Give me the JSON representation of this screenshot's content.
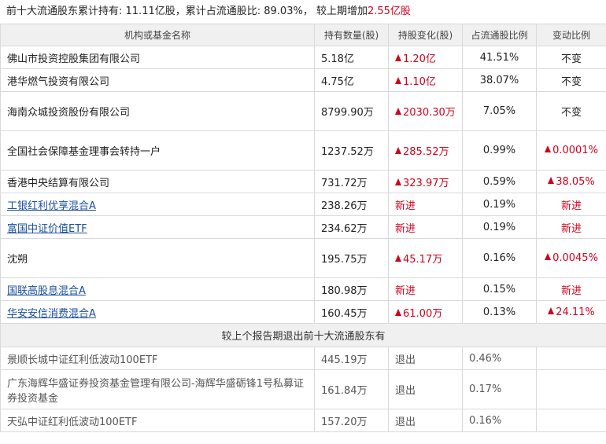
{
  "summary": {
    "prefix": "前十大流通股东累计持有: ",
    "total_hold": "11.11亿股",
    "ratio_label": "，累计占流通股比: ",
    "ratio": "89.03%",
    "change_label": "， 较上期增加",
    "change_value": "2.55亿股"
  },
  "table": {
    "headers": [
      "机构或基金名称",
      "持有数量(股)",
      "持股变化(股)",
      "占流通股比例",
      "变动比例"
    ],
    "rows": [
      {
        "name": "佛山市投资控股集团有限公司",
        "link": false,
        "qty": "5.18亿",
        "change": "1.20亿",
        "change_up": true,
        "ratio": "41.51%",
        "pct": "不变",
        "pct_up": false,
        "pct_red": false
      },
      {
        "name": "港华燃气投资有限公司",
        "link": false,
        "qty": "4.75亿",
        "change": "1.10亿",
        "change_up": true,
        "ratio": "38.07%",
        "pct": "不变",
        "pct_up": false,
        "pct_red": false
      },
      {
        "name": "海南众城投资股份有限公司",
        "link": false,
        "qty": "8799.90万",
        "change": "2030.30万",
        "change_up": true,
        "ratio": "7.05%",
        "pct": "不变",
        "pct_up": false,
        "pct_red": false
      },
      {
        "name": "全国社会保障基金理事会转持一户",
        "link": false,
        "qty": "1237.52万",
        "change": "285.52万",
        "change_up": true,
        "ratio": "0.99%",
        "pct": "0.0001%",
        "pct_up": true,
        "pct_red": true
      },
      {
        "name": "香港中央结算有限公司",
        "link": false,
        "qty": "731.72万",
        "change": "323.97万",
        "change_up": true,
        "ratio": "0.59%",
        "pct": "38.05%",
        "pct_up": true,
        "pct_red": true
      },
      {
        "name": "工银红利优享混合A",
        "link": true,
        "qty": "238.26万",
        "change": "新进",
        "change_up": false,
        "ratio": "0.19%",
        "pct": "新进",
        "pct_up": false,
        "pct_red": true
      },
      {
        "name": "富国中证价值ETF",
        "link": true,
        "qty": "234.62万",
        "change": "新进",
        "change_up": false,
        "ratio": "0.19%",
        "pct": "新进",
        "pct_up": false,
        "pct_red": true
      },
      {
        "name": "沈朔",
        "link": false,
        "qty": "195.75万",
        "change": "45.17万",
        "change_up": true,
        "ratio": "0.16%",
        "pct": "0.0045%",
        "pct_up": true,
        "pct_red": true
      },
      {
        "name": "国联高股息混合A",
        "link": true,
        "qty": "180.98万",
        "change": "新进",
        "change_up": false,
        "ratio": "0.15%",
        "pct": "新进",
        "pct_up": false,
        "pct_red": true
      },
      {
        "name": "华安安信消费混合A",
        "link": true,
        "qty": "160.45万",
        "change": "61.00万",
        "change_up": true,
        "ratio": "0.13%",
        "pct": "24.11%",
        "pct_up": true,
        "pct_red": true
      }
    ],
    "section_title": "较上个报告期退出前十大流通股东有",
    "exits": [
      {
        "name": "景顺长城中证红利低波动100ETF",
        "qty": "445.19万",
        "change": "退出",
        "ratio": "0.46%"
      },
      {
        "name": "广东海辉华盛证券投资基金管理有限公司-海辉华盛砺锋1号私募证券投资基金",
        "qty": "161.84万",
        "change": "退出",
        "ratio": "0.17%"
      },
      {
        "name": "天弘中证红利低波动100ETF",
        "qty": "157.20万",
        "change": "退出",
        "ratio": "0.16%"
      }
    ]
  },
  "colors": {
    "up": "#d0021b",
    "link": "#1a4f9c",
    "header_bg": "#f0f0f0"
  }
}
